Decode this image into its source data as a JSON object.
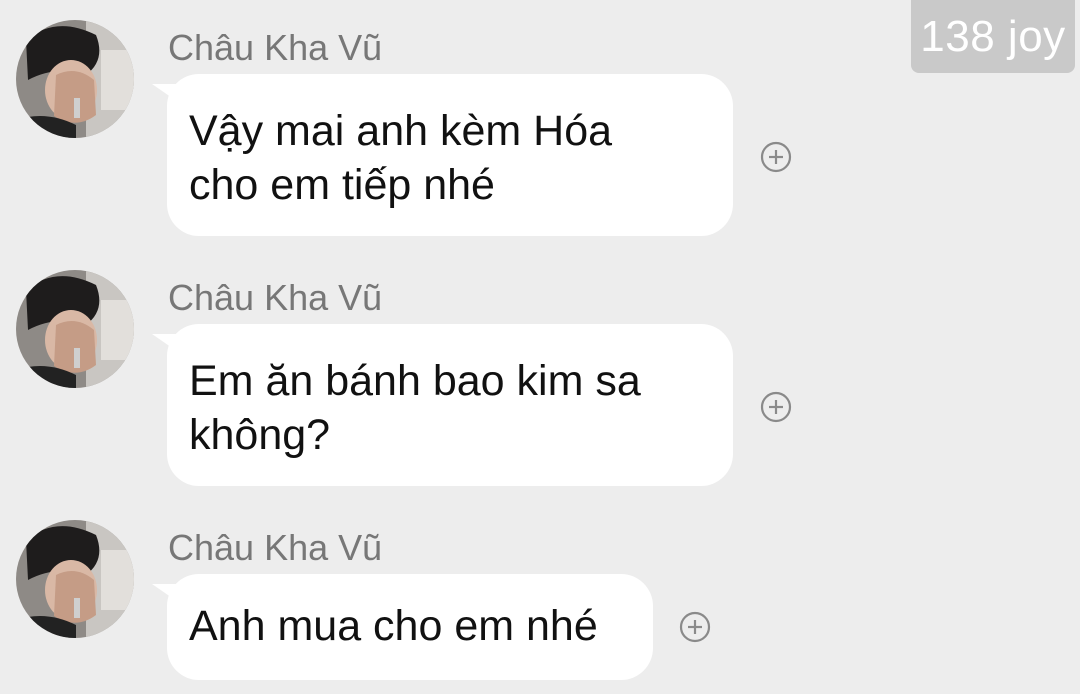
{
  "watermark": "138 joy",
  "colors": {
    "background": "#ededed",
    "bubble": "#ffffff",
    "sender_text": "#777777",
    "message_text": "#111111",
    "watermark_bg": "#c9c9c9"
  },
  "messages": [
    {
      "sender": "Châu Kha Vũ",
      "lines": [
        "Vậy mai anh kèm Hóa",
        "cho em tiếp nhé"
      ],
      "action_icon": "plus-circle-icon"
    },
    {
      "sender": "Châu Kha Vũ",
      "lines": [
        "Em ăn bánh bao kim sa",
        "không?"
      ],
      "action_icon": "plus-circle-icon"
    },
    {
      "sender": "Châu Kha Vũ",
      "lines": [
        "Anh mua cho em nhé"
      ],
      "action_icon": "plus-circle-icon"
    }
  ]
}
